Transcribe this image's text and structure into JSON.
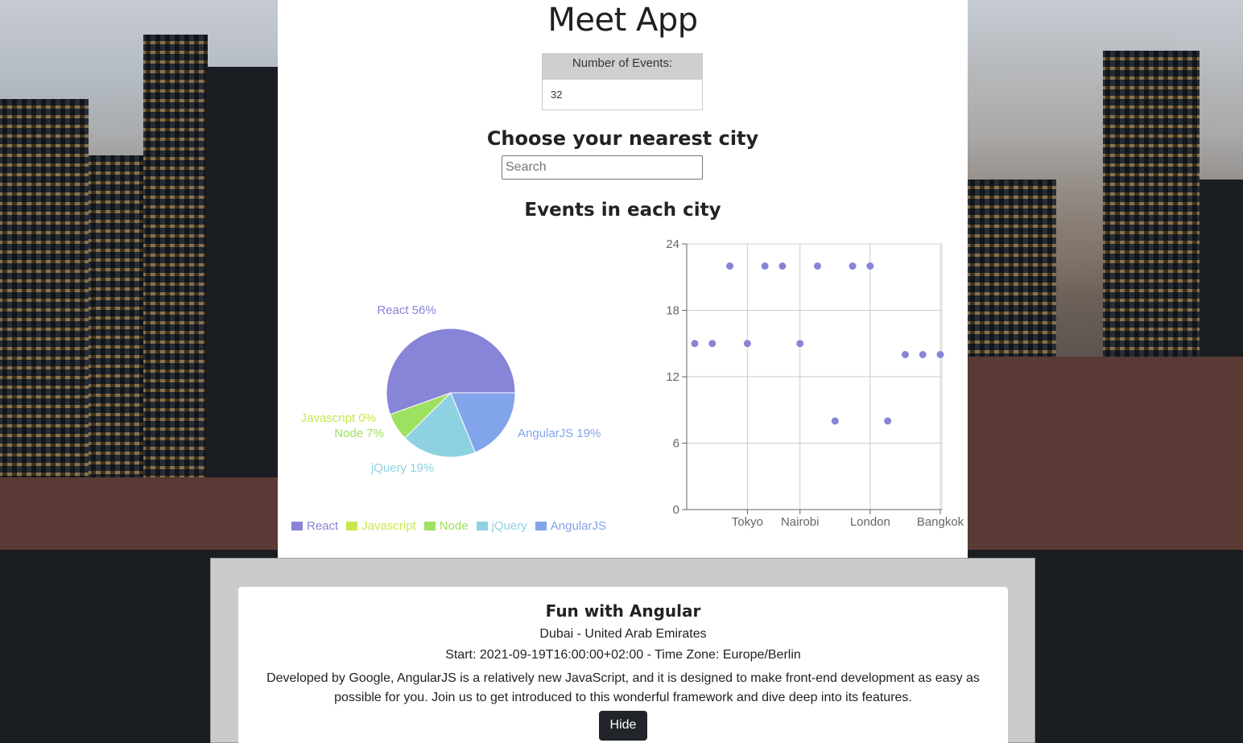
{
  "app": {
    "title": "Meet App"
  },
  "number_of_events": {
    "label": "Number of Events:",
    "value": "32"
  },
  "city_search": {
    "title": "Choose your nearest city",
    "placeholder": "Search",
    "value": ""
  },
  "charts_title": "Events in each city",
  "chart_data": [
    {
      "type": "pie",
      "slices": [
        {
          "label": "React",
          "percent": 56,
          "color": "#8884d8"
        },
        {
          "label": "Javascript",
          "percent": 0,
          "color": "#c6e94b"
        },
        {
          "label": "Node",
          "percent": 7,
          "color": "#9ee060"
        },
        {
          "label": "jQuery",
          "percent": 19,
          "color": "#8ed1e1"
        },
        {
          "label": "AngularJS",
          "percent": 19,
          "color": "#82a4ea"
        }
      ],
      "slice_labels": [
        "React 56%",
        "Javascript 0%",
        "Node 7%",
        "jQuery 19%",
        "AngularJS 19%"
      ],
      "legend": [
        "React",
        "Javascript",
        "Node",
        "jQuery",
        "AngularJS"
      ],
      "legend_placement": "bottom"
    },
    {
      "type": "scatter",
      "color": "#8884d8",
      "ylim": [
        0,
        24
      ],
      "yticks": [
        0,
        6,
        12,
        18,
        24
      ],
      "xtick_labels": [
        "Tokyo",
        "Nairobi",
        "London",
        "Bangkok"
      ],
      "points": [
        15,
        15,
        22,
        15,
        22,
        22,
        15,
        22,
        8,
        22,
        22,
        8,
        14,
        14,
        14
      ],
      "xtick_positions": [
        3,
        6,
        10,
        14
      ],
      "grid": true
    }
  ],
  "event": {
    "name": "Fun with Angular",
    "location": "Dubai - United Arab Emirates",
    "start": "Start: 2021-09-19T16:00:00+02:00 - Time Zone: Europe/Berlin",
    "description": "Developed by Google, AngularJS is a relatively new JavaScript, and it is designed to make front-end development as easy as possible for you. Join us to get introduced to this wonderful framework and dive deep into its features.",
    "hide_label": "Hide"
  }
}
